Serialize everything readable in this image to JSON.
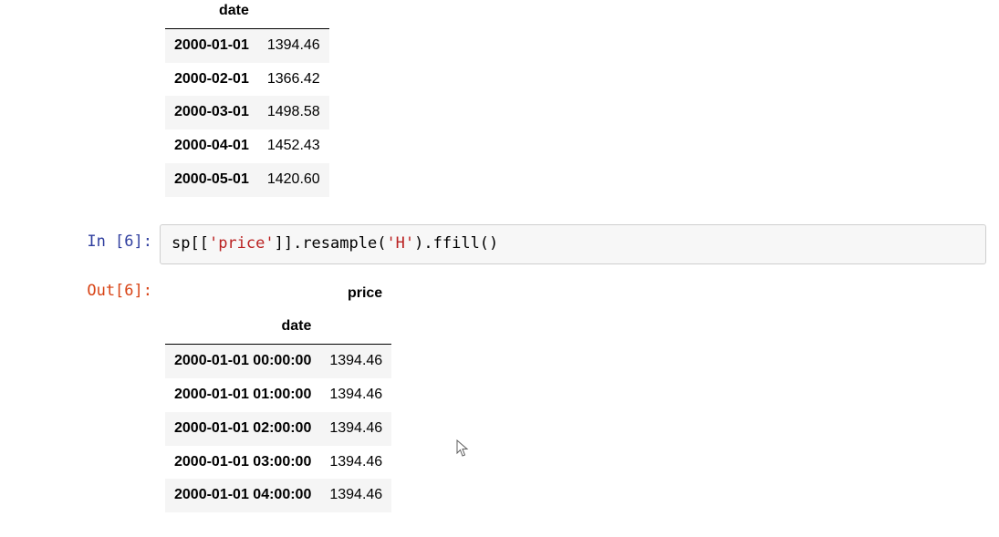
{
  "table1": {
    "index_name": "date",
    "rows": [
      {
        "date": "2000-01-01",
        "value": "1394.46"
      },
      {
        "date": "2000-02-01",
        "value": "1366.42"
      },
      {
        "date": "2000-03-01",
        "value": "1498.58"
      },
      {
        "date": "2000-04-01",
        "value": "1452.43"
      },
      {
        "date": "2000-05-01",
        "value": "1420.60"
      }
    ]
  },
  "code_cell": {
    "in_prompt": "In [6]:",
    "out_prompt": "Out[6]:",
    "code_pre": "sp[[",
    "code_str1": "'price'",
    "code_mid": "]].resample(",
    "code_str2": "'H'",
    "code_post": ").ffill()"
  },
  "table2": {
    "column": "price",
    "index_name": "date",
    "rows": [
      {
        "date": "2000-01-01 00:00:00",
        "value": "1394.46"
      },
      {
        "date": "2000-01-01 01:00:00",
        "value": "1394.46"
      },
      {
        "date": "2000-01-01 02:00:00",
        "value": "1394.46"
      },
      {
        "date": "2000-01-01 03:00:00",
        "value": "1394.46"
      },
      {
        "date": "2000-01-01 04:00:00",
        "value": "1394.46"
      }
    ]
  }
}
